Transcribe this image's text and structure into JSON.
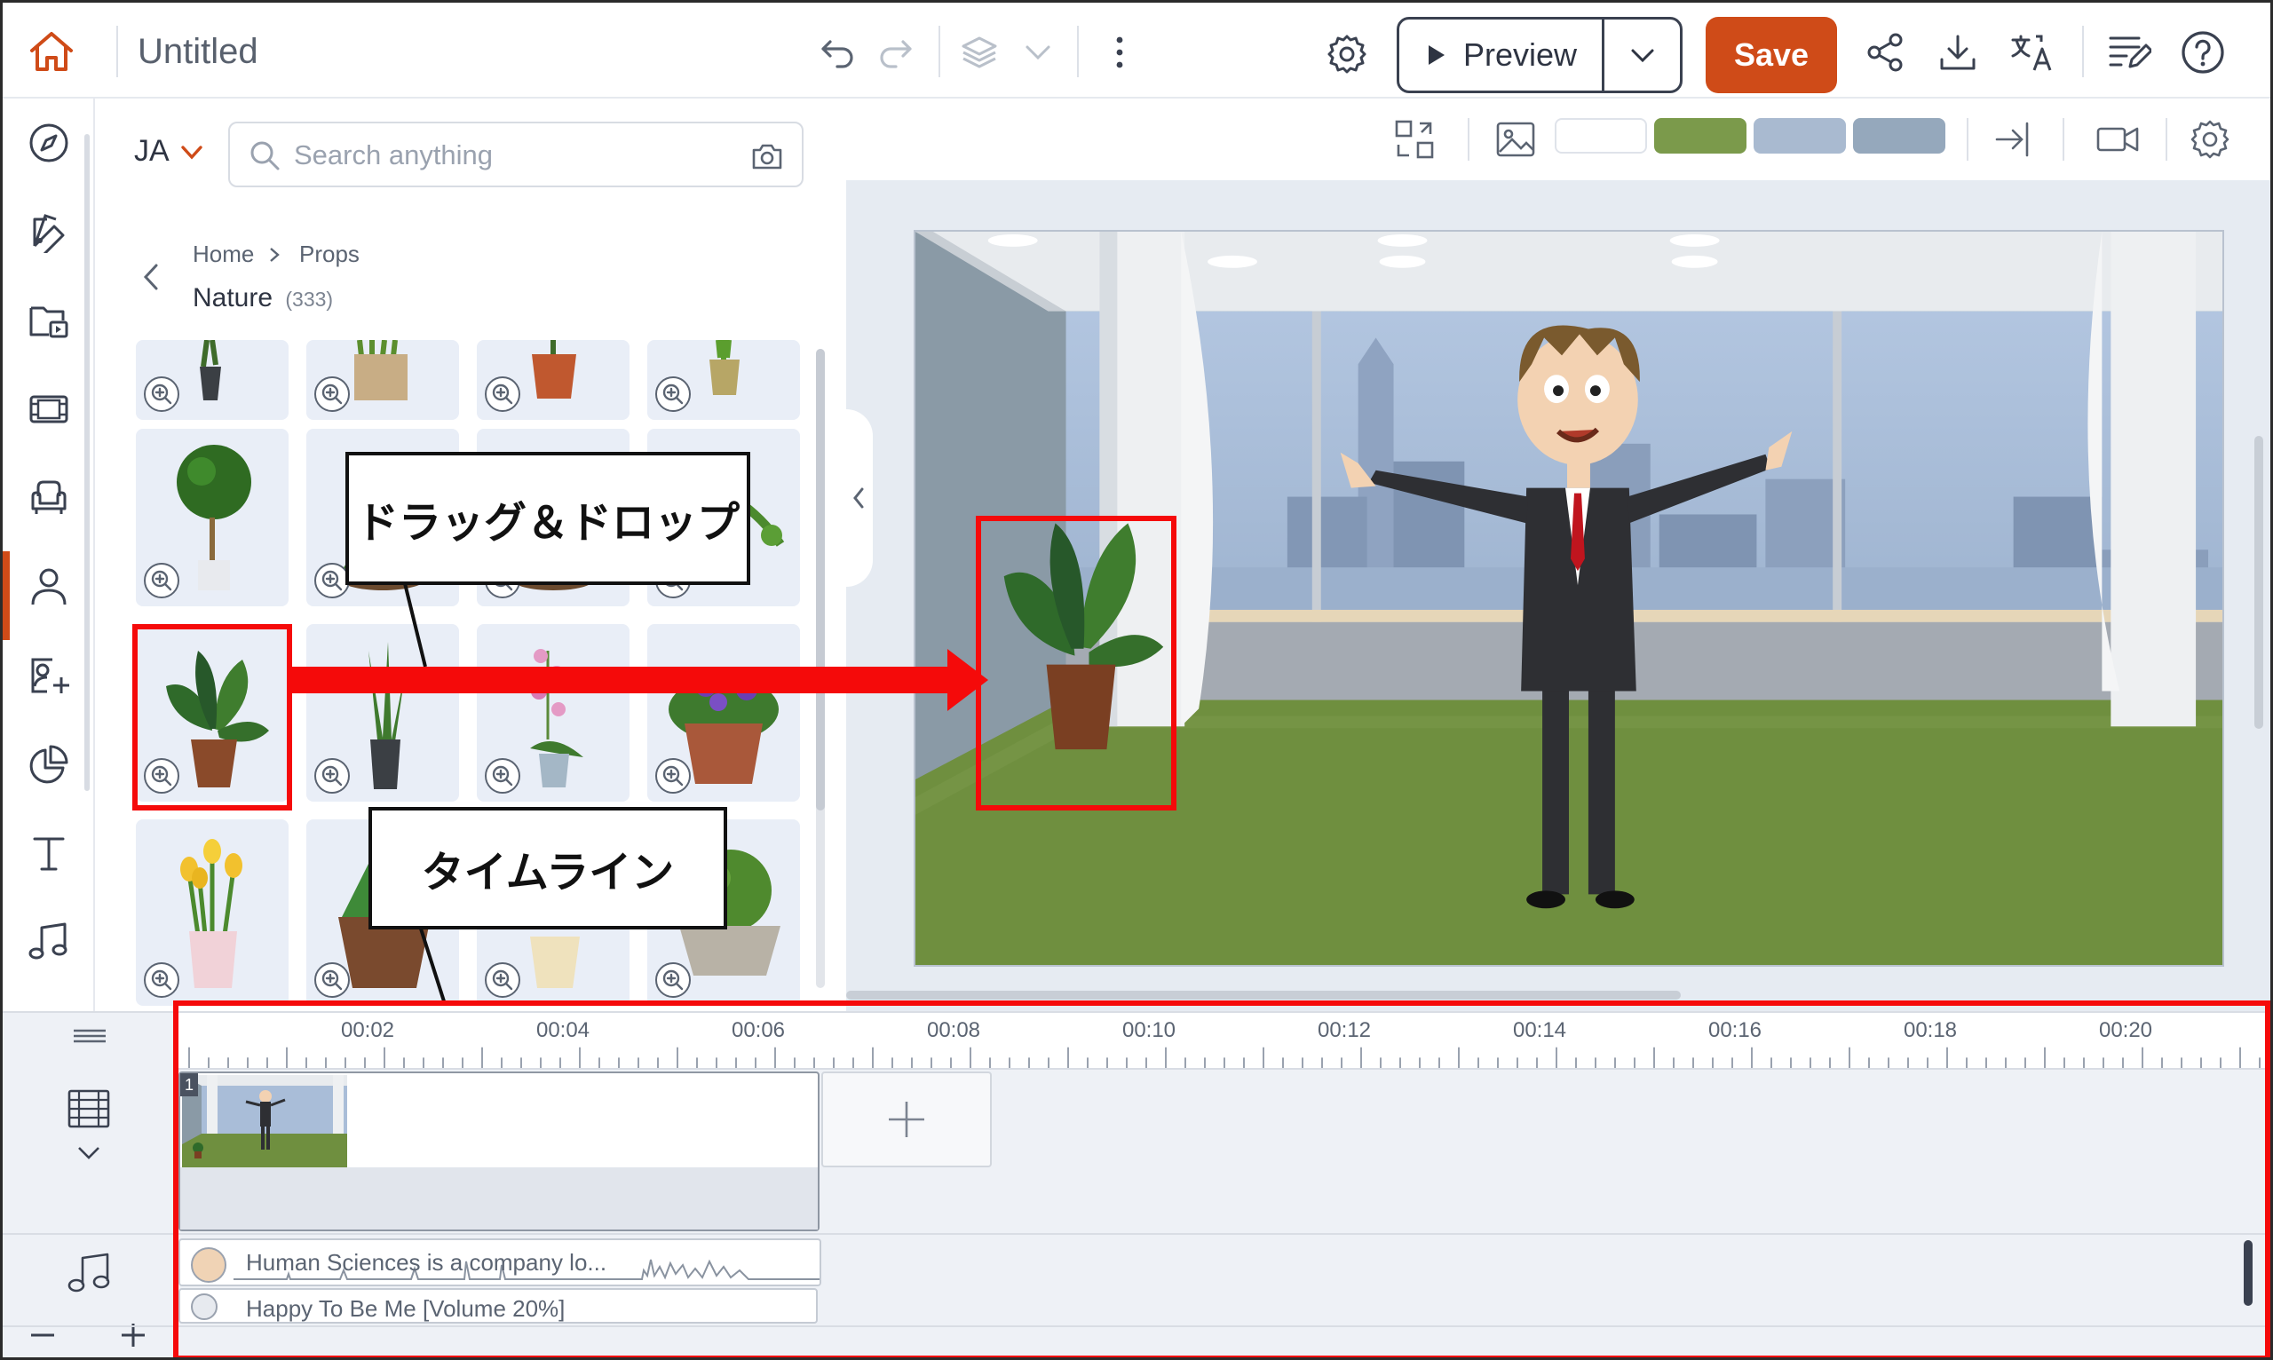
{
  "header": {
    "title": "Untitled",
    "preview_label": "Preview",
    "save_label": "Save",
    "icons": [
      "home-icon",
      "undo-icon",
      "redo-icon",
      "layers-icon",
      "chevron-down-icon",
      "more-vertical-icon",
      "gear-icon",
      "play-icon",
      "share-icon",
      "download-icon",
      "translate-icon",
      "notes-icon",
      "help-icon"
    ],
    "accent_color": "#cf4b18"
  },
  "sidebar": {
    "items": [
      {
        "name": "explore",
        "icon": "compass-icon"
      },
      {
        "name": "themes",
        "icon": "palette-icon"
      },
      {
        "name": "media",
        "icon": "folder-video-icon"
      },
      {
        "name": "scenes",
        "icon": "film-icon"
      },
      {
        "name": "props",
        "icon": "armchair-icon",
        "active": true
      },
      {
        "name": "characters",
        "icon": "person-icon"
      },
      {
        "name": "character-creator",
        "icon": "person-card-icon"
      },
      {
        "name": "charts",
        "icon": "pie-chart-icon"
      },
      {
        "name": "text",
        "icon": "text-icon"
      },
      {
        "name": "audio",
        "icon": "music-note-icon"
      }
    ]
  },
  "asset_panel": {
    "language": "JA",
    "search_placeholder": "Search anything",
    "breadcrumb": [
      "Home",
      "Props"
    ],
    "category": "Nature",
    "category_count": "(333)",
    "tiles": [
      "small-potted-plant",
      "boxed-grass-plant",
      "red-pot-plant",
      "yellow-pot-plant",
      "topiary-tree",
      "fern-in-pot",
      "hidden-plant",
      "hanging-plant",
      "monstera-plant",
      "snake-plant",
      "pink-orchid",
      "purple-violets",
      "yellow-tulips",
      "aloe-plant",
      "cream-pot-plant",
      "round-bush"
    ]
  },
  "stage": {
    "toolbar_icons": [
      "swap-layout-icon",
      "image-icon",
      "import-icon",
      "camera-icon",
      "gear-icon"
    ],
    "swatches": [
      "#ffffff",
      "#7b9a4b",
      "#a9bad0",
      "#95a8bc"
    ],
    "zoom_icons": [
      "grid-icon",
      "minus-icon",
      "fit-icon",
      "plus-icon",
      "panel-icon"
    ]
  },
  "timeline": {
    "ticks": [
      "00:02",
      "00:04",
      "00:06",
      "00:08",
      "00:10",
      "00:12",
      "00:14",
      "00:16",
      "00:18",
      "00:20"
    ],
    "scene_number": "1",
    "audio_tracks": [
      "Human Sciences is a company lo...",
      "Happy To Be Me [Volume 20%]"
    ]
  },
  "annotations": {
    "drag_drop_label": "ドラッグ＆ドロップ",
    "timeline_label": "タイムライン",
    "color": "#f50a0a"
  }
}
